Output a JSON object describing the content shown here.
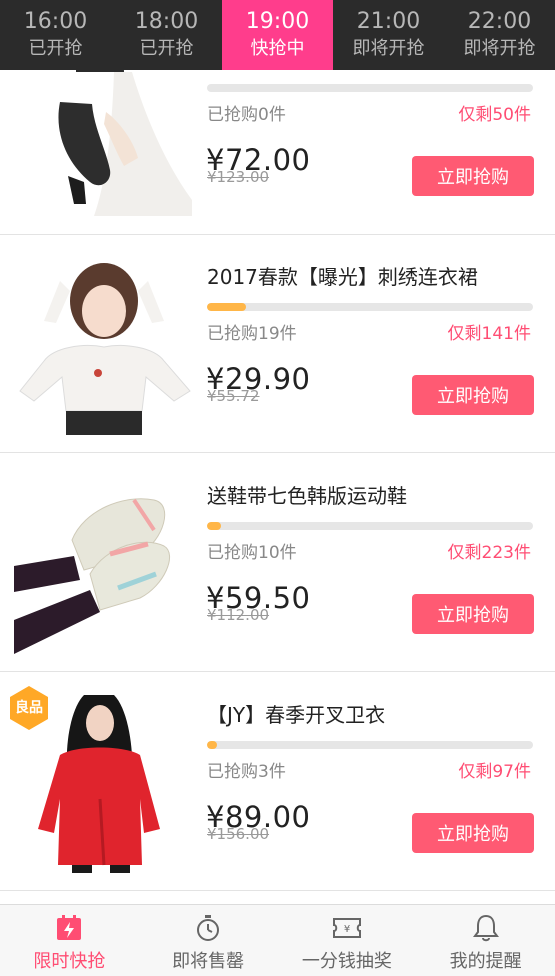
{
  "time_slots": [
    {
      "time": "16:00",
      "status": "已开抢",
      "active": false
    },
    {
      "time": "18:00",
      "status": "已开抢",
      "active": false
    },
    {
      "time": "19:00",
      "status": "快抢中",
      "active": true
    },
    {
      "time": "21:00",
      "status": "即将开抢",
      "active": false
    },
    {
      "time": "22:00",
      "status": "即将开抢",
      "active": false
    }
  ],
  "items": [
    {
      "name": "",
      "progress": 0,
      "sold": "已抢购0件",
      "remaining": "仅剩50件",
      "price": "¥72.00",
      "original": "¥123.00",
      "button": "立即抢购"
    },
    {
      "name": "2017春款【曝光】刺绣连衣裙",
      "progress": 0.12,
      "sold": "已抢购19件",
      "remaining": "仅剩141件",
      "price": "¥29.90",
      "original": "¥55.72",
      "button": "立即抢购"
    },
    {
      "name": "送鞋带七色韩版运动鞋",
      "progress": 0.043,
      "sold": "已抢购10件",
      "remaining": "仅剩223件",
      "price": "¥59.50",
      "original": "¥112.00",
      "button": "立即抢购"
    },
    {
      "name": "【JY】春季开叉卫衣",
      "progress": 0.03,
      "sold": "已抢购3件",
      "remaining": "仅剩97件",
      "price": "¥89.00",
      "original": "¥156.00",
      "button": "立即抢购",
      "badge": "良品"
    }
  ],
  "nav": [
    {
      "label": "限时快抢",
      "icon": "flash-icon",
      "active": true
    },
    {
      "label": "即将售罄",
      "icon": "timer-icon",
      "active": false
    },
    {
      "label": "一分钱抽奖",
      "icon": "ticket-icon",
      "active": false
    },
    {
      "label": "我的提醒",
      "icon": "bell-icon",
      "active": false
    }
  ],
  "colors": {
    "accent": "#ff3d8c",
    "button": "#ff5a73",
    "progress": "#ffb648",
    "badge": "#ffa826"
  }
}
